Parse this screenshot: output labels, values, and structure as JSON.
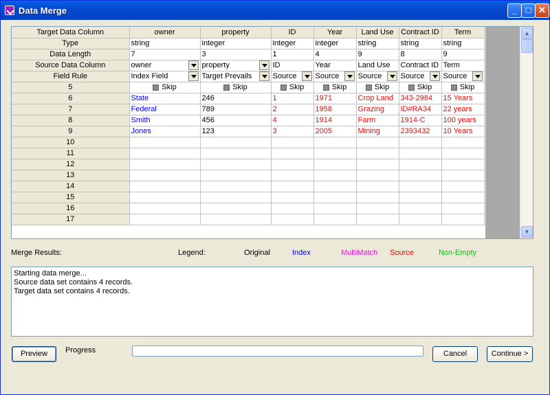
{
  "window": {
    "title": "Data Merge"
  },
  "grid": {
    "header_label": "Target Data Column",
    "columns": [
      "owner",
      "property",
      "ID",
      "Year",
      "Land Use",
      "Contract ID",
      "Term"
    ],
    "type_row": {
      "label": "Type",
      "values": [
        "string",
        "integer",
        "integer",
        "integer",
        "string",
        "string",
        "string"
      ]
    },
    "length_row": {
      "label": "Data Length",
      "values": [
        "7",
        "3",
        "1",
        "4",
        "9",
        "8",
        "9"
      ]
    },
    "source_row": {
      "label": "Source Data Column",
      "values": [
        "owner",
        "property",
        "ID",
        "Year",
        "Land Use",
        "Contract ID",
        "Term"
      ]
    },
    "rule_row": {
      "label": "Field Rule",
      "values": [
        "Index Field",
        "Target Prevails",
        "Source",
        "Source",
        "Source",
        "Source",
        "Source"
      ]
    },
    "skip_row": {
      "label": "5",
      "skip_label": "Skip"
    },
    "data_rows": [
      {
        "label": "6",
        "values": [
          "State",
          "246",
          "1",
          "1971",
          "Crop Land",
          "343-2984",
          "15 Years"
        ]
      },
      {
        "label": "7",
        "values": [
          "Federal",
          "789",
          "2",
          "1958",
          "Grazing",
          "ID#RA34",
          "22 years"
        ]
      },
      {
        "label": "8",
        "values": [
          "Smith",
          "456",
          "4",
          "1914",
          "Farm",
          "1914-C",
          "100 years"
        ]
      },
      {
        "label": "9",
        "values": [
          "Jones",
          "123",
          "3",
          "2005",
          "Mining",
          "2393432",
          "10 Years"
        ]
      }
    ],
    "empty_rows": [
      "10",
      "11",
      "12",
      "13",
      "14",
      "15",
      "16",
      "17"
    ]
  },
  "merge": {
    "results_label": "Merge Results:",
    "legend_label": "Legend:",
    "legend": [
      {
        "text": "Original",
        "color": "#000000"
      },
      {
        "text": "Index",
        "color": "#0000ff"
      },
      {
        "text": "MultiMatch",
        "color": "#ff00ff"
      },
      {
        "text": "Source",
        "color": "#ff0000"
      },
      {
        "text": "Non-Empty",
        "color": "#00cc00"
      }
    ],
    "log_lines": [
      "Starting data merge...",
      "Source data set contains 4 records.",
      "Target data set contains 4 records."
    ]
  },
  "footer": {
    "preview_label": "Preview",
    "progress_label": "Progress",
    "progress_value": 0,
    "cancel_label": "Cancel",
    "continue_label": "Continue >"
  }
}
